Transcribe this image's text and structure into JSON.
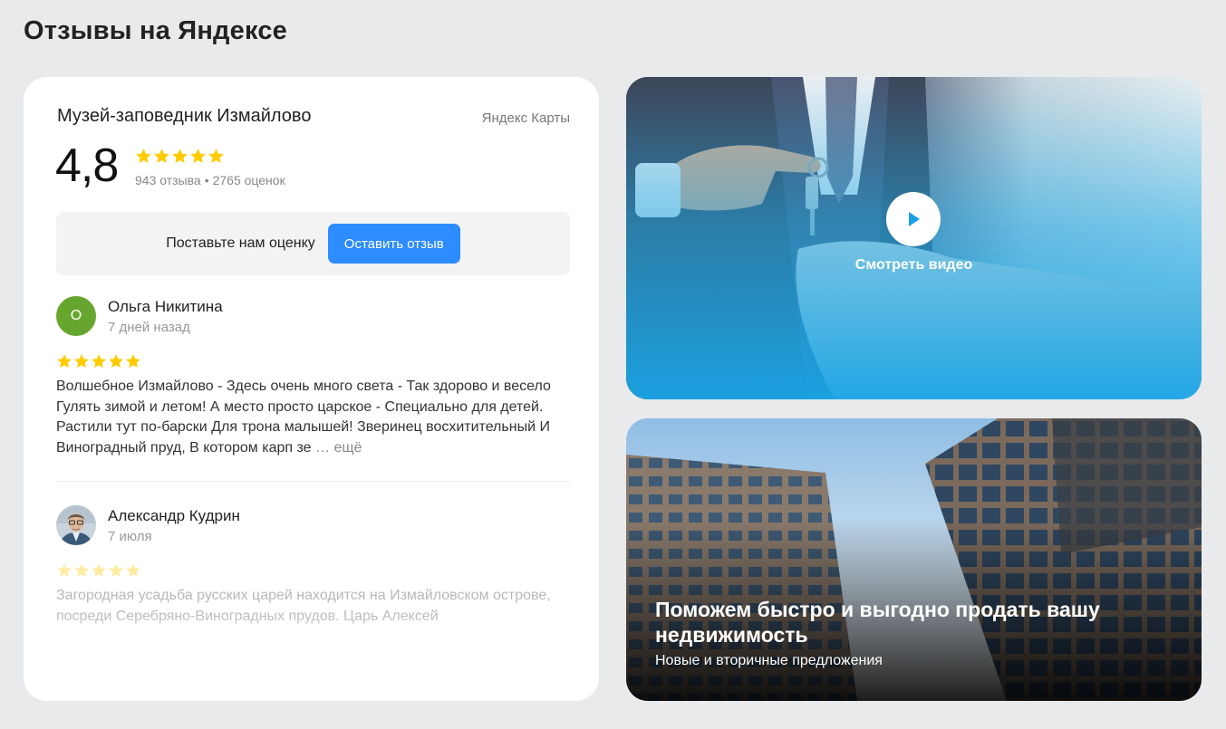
{
  "section_title": "Отзывы на Яндексе",
  "widget": {
    "org_name": "Музей-заповедник Измайлово",
    "brand": "Яндекс Карты",
    "rating": "4,8",
    "reviews_count": "943 отзыва",
    "separator": "•",
    "ratings_count": "2765 оценок",
    "cta_text": "Поставьте нам оценку",
    "cta_button": "Оставить отзыв",
    "star_color": "#ffcc00",
    "reviews": [
      {
        "avatar_letter": "О",
        "author": "Ольга Никитина",
        "date": "7 дней назад",
        "stars": 5,
        "text": "Волшебное Измайлово - Здесь очень много света - Так здорово и весело Гулять зимой и летом! А место просто царское - Специально для детей. Растили тут по-барски Для трона малышей! Зверинец восхитительный И Виноградный пруд, В котором карп зе",
        "more": "… ещё"
      },
      {
        "author": "Александр Кудрин",
        "date": "7 июля",
        "stars": 5,
        "text": "Загородная усадьба русских царей находится на Измайловском острове, посреди Серебряно-Виноградных прудов. Царь Алексей"
      }
    ]
  },
  "video": {
    "label": "Смотреть видео"
  },
  "promo": {
    "title": "Поможем быстро и выгодно продать вашу недвижимость",
    "subtitle": "Новые и вторичные предложения"
  }
}
